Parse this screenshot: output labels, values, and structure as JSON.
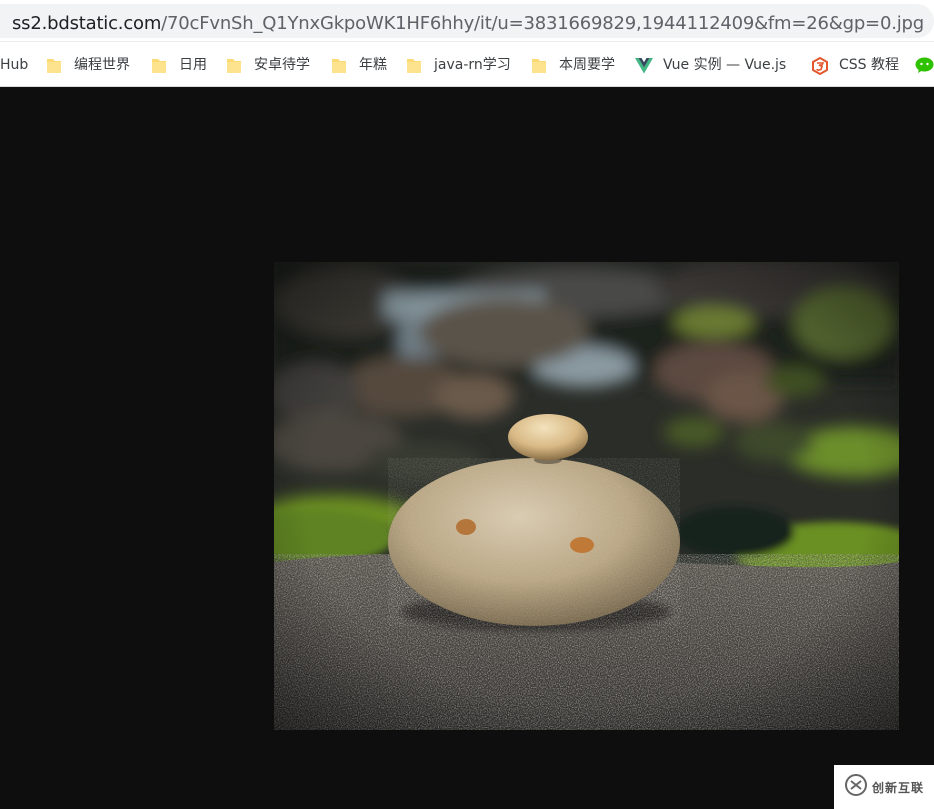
{
  "address_bar": {
    "host": "ss2.bdstatic.com",
    "path": "/70cFvnSh_Q1YnxGkpoWK1HF6hhy/it/u=3831669829,1944112409&fm=26&gp=0.jpg"
  },
  "bookmarks": {
    "items": [
      {
        "label": "Hub",
        "icon": "none"
      },
      {
        "label": "编程世界",
        "icon": "folder-icon"
      },
      {
        "label": "日用",
        "icon": "folder-icon"
      },
      {
        "label": "安卓待学",
        "icon": "folder-icon"
      },
      {
        "label": "年糕",
        "icon": "folder-icon"
      },
      {
        "label": "java-rn学习",
        "icon": "folder-icon"
      },
      {
        "label": "本周要学",
        "icon": "folder-icon"
      },
      {
        "label": "Vue 实例 — Vue.js",
        "icon": "vue-logo-icon"
      },
      {
        "label": "CSS 教程",
        "icon": "css-logo-icon"
      }
    ]
  },
  "watermark": {
    "text": "创新互联"
  },
  "colors": {
    "viewer_background": "#0e0e0e",
    "folder": "#fbd973",
    "vue_green": "#41b883",
    "vue_dark": "#34495e",
    "css_red": "#e4572e",
    "wechat_green": "#2dc100"
  }
}
